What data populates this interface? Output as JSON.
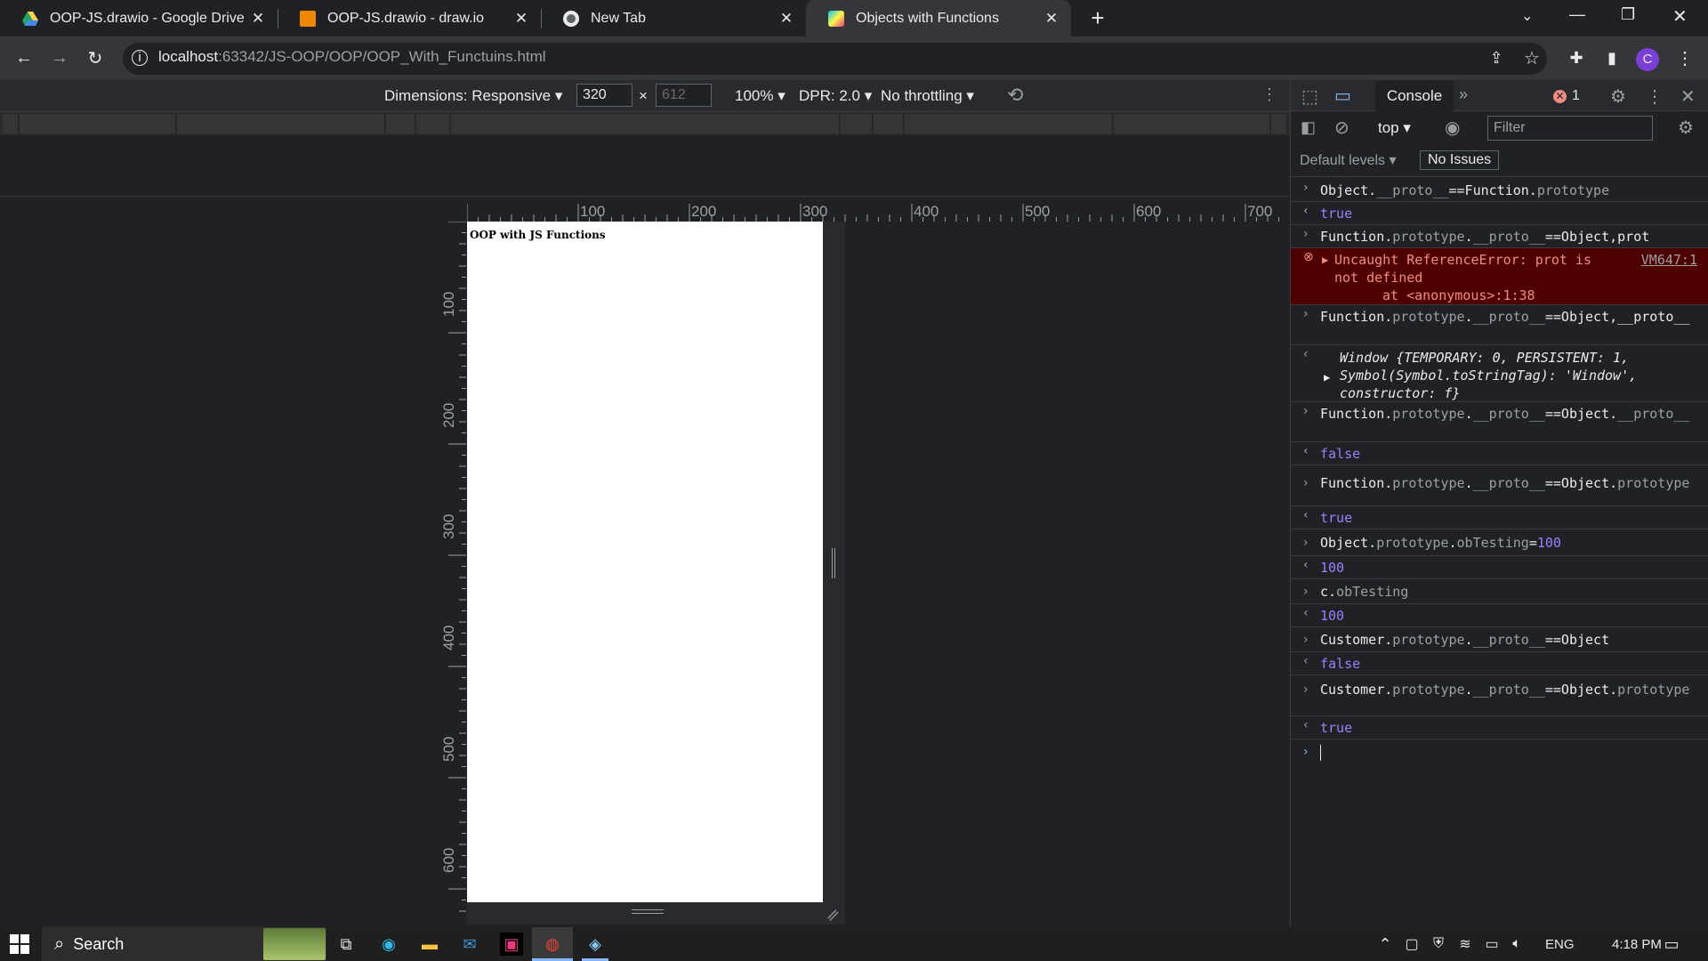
{
  "tabs": [
    {
      "title": "OOP-JS.drawio - Google Drive",
      "icon": "google-drive-icon"
    },
    {
      "title": "OOP-JS.drawio - draw.io",
      "icon": "drawio-icon"
    },
    {
      "title": "New Tab",
      "icon": "chrome-icon"
    },
    {
      "title": "Objects with Functions",
      "icon": "webstorm-icon"
    }
  ],
  "url": {
    "host": "localhost",
    "rest": ":63342/JS-OOP/OOP/OOP_With_Functuins.html"
  },
  "avatar": "C",
  "device": {
    "dimensions": "Dimensions: Responsive",
    "width": "320",
    "height": "612",
    "zoom": "100%",
    "dpr": "DPR: 2.0",
    "throttle": "No throttling"
  },
  "rulers": {
    "h": [
      "100",
      "200",
      "300",
      "400",
      "500",
      "600",
      "700"
    ],
    "v": [
      "100",
      "200",
      "300",
      "400",
      "500",
      "600"
    ]
  },
  "page": {
    "title": "OOP with JS Functions"
  },
  "devtools": {
    "tab": "Console",
    "errors": "1",
    "context": "top",
    "filter_placeholder": "Filter",
    "levels": "Default levels",
    "issues": "No Issues"
  },
  "console": [
    {
      "kind": "in",
      "text": "Object.__proto__==Function.prototype"
    },
    {
      "kind": "out",
      "text": "true"
    },
    {
      "kind": "in",
      "text": "Function.prototype.__proto__==Object,prot"
    },
    {
      "kind": "err",
      "text": "Uncaught ReferenceError: prot is not defined",
      "trace": "at <anonymous>:1:38",
      "link": "VM647:1"
    },
    {
      "kind": "in",
      "text": "Function.prototype.__proto__==Object,__proto__"
    },
    {
      "kind": "obj",
      "text": "Window {TEMPORARY: 0, PERSISTENT: 1, Symbol(Symbol.toStringTag): 'Window', constructor: f}"
    },
    {
      "kind": "in",
      "text": "Function.prototype.__proto__==Object.__proto__"
    },
    {
      "kind": "out",
      "text": "false"
    },
    {
      "kind": "in",
      "text": "Function.prototype.__proto__==Object.prototype"
    },
    {
      "kind": "out",
      "text": "true"
    },
    {
      "kind": "in",
      "text": "Object.prototype.obTesting=100"
    },
    {
      "kind": "out",
      "text": "100"
    },
    {
      "kind": "in",
      "text": "c.obTesting"
    },
    {
      "kind": "out",
      "text": "100"
    },
    {
      "kind": "in",
      "text": "Customer.prototype.__proto__==Object"
    },
    {
      "kind": "out",
      "text": "false"
    },
    {
      "kind": "in",
      "text": "Customer.prototype.__proto__==Object.prototype"
    },
    {
      "kind": "out",
      "text": "true"
    }
  ],
  "taskbar": {
    "search": "Search",
    "lang": "ENG",
    "time": "4:18 PM"
  }
}
